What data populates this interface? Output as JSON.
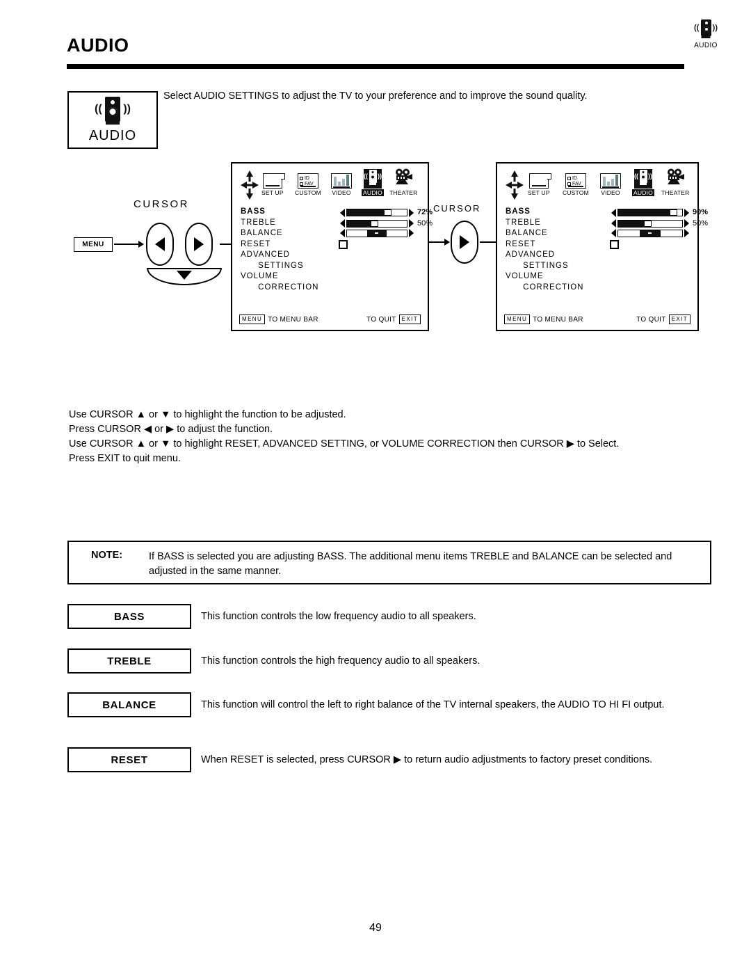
{
  "header": {
    "title": "AUDIO",
    "corner_icon": "speaker-icon",
    "corner_label": "AUDIO"
  },
  "audio_panel": {
    "icon": "speaker-icon",
    "label": "AUDIO"
  },
  "intro_text": "Select AUDIO SETTINGS to adjust the TV to your preference and to improve the sound quality.",
  "cursor_diagram": {
    "caption": "CURSOR",
    "menu_button": "MENU",
    "left_icon": "cursor-left-icon",
    "right_icon": "cursor-right-icon",
    "down_icon": "cursor-down-icon"
  },
  "mid_cursor": {
    "caption": "CURSOR",
    "icon": "cursor-right-icon"
  },
  "menu_bar": {
    "nav_icon": "up-down-left-right-arrows-icon",
    "items": [
      {
        "label": "SET UP",
        "icon": "setup-icon",
        "selected": false
      },
      {
        "label": "CUSTOM",
        "icon": "custom-icon",
        "selected": false,
        "line1": "ID",
        "line2": "FAV"
      },
      {
        "label": "VIDEO",
        "icon": "video-icon",
        "selected": false
      },
      {
        "label": "AUDIO",
        "icon": "speaker-icon",
        "selected": true
      },
      {
        "label": "THEATER",
        "icon": "movie-camera-icon",
        "selected": false
      }
    ]
  },
  "osd_screens": [
    {
      "name": "osd-before",
      "rows": [
        {
          "label": "BASS",
          "bold": true,
          "control": "slider",
          "value": 72,
          "value_text": "72%"
        },
        {
          "label": "TREBLE",
          "bold": false,
          "control": "slider",
          "value": 50,
          "value_text": "50%"
        },
        {
          "label": "BALANCE",
          "bold": false,
          "control": "balance",
          "value": 50,
          "value_text": ""
        },
        {
          "label": "RESET",
          "bold": false,
          "control": "checkbox"
        },
        {
          "label": "ADVANCED",
          "bold": false,
          "control": "none"
        },
        {
          "label": "   SETTINGS",
          "bold": false,
          "control": "none"
        },
        {
          "label": "VOLUME",
          "bold": false,
          "control": "none"
        },
        {
          "label": "   CORRECTION",
          "bold": false,
          "control": "none"
        }
      ],
      "footer": {
        "menu_key": "MENU",
        "menu_text": "TO MENU BAR",
        "quit_text": "TO QUIT",
        "exit_key": "EXIT"
      }
    },
    {
      "name": "osd-after",
      "rows": [
        {
          "label": "BASS",
          "bold": true,
          "control": "slider",
          "value": 90,
          "value_text": "90%"
        },
        {
          "label": "TREBLE",
          "bold": false,
          "control": "slider",
          "value": 50,
          "value_text": "50%"
        },
        {
          "label": "BALANCE",
          "bold": false,
          "control": "balance",
          "value": 50,
          "value_text": ""
        },
        {
          "label": "RESET",
          "bold": false,
          "control": "checkbox"
        },
        {
          "label": "ADVANCED",
          "bold": false,
          "control": "none"
        },
        {
          "label": "   SETTINGS",
          "bold": false,
          "control": "none"
        },
        {
          "label": "VOLUME",
          "bold": false,
          "control": "none"
        },
        {
          "label": "   CORRECTION",
          "bold": false,
          "control": "none"
        }
      ],
      "footer": {
        "menu_key": "MENU",
        "menu_text": "TO MENU BAR",
        "quit_text": "TO QUIT",
        "exit_key": "EXIT"
      }
    }
  ],
  "instructions": [
    "Use CURSOR ▲ or ▼ to highlight the function to be adjusted.",
    "Press CURSOR ◀ or ▶ to adjust the function.",
    "Use CURSOR ▲ or ▼ to highlight RESET, ADVANCED SETTING, or VOLUME CORRECTION then CURSOR ▶ to Select.",
    "Press EXIT to quit menu."
  ],
  "note": {
    "label": "NOTE:",
    "text": "If BASS is selected you are adjusting BASS.  The additional menu items TREBLE and BALANCE can be selected and adjusted in the same manner."
  },
  "definitions": [
    {
      "label": "BASS",
      "text": "This function controls the low frequency audio to all speakers."
    },
    {
      "label": "TREBLE",
      "text": "This function controls the high frequency audio to all speakers."
    },
    {
      "label": "BALANCE",
      "text": "This function will control the left to right balance of the TV internal speakers, the AUDIO TO HI FI output."
    },
    {
      "label": "RESET",
      "text": "When RESET is selected, press CURSOR ▶ to return audio adjustments to factory preset conditions."
    }
  ],
  "page_number": "49",
  "colors": {
    "ink": "#000000",
    "panel_fill": "#111111",
    "video_bar": "#9fb7bd"
  }
}
